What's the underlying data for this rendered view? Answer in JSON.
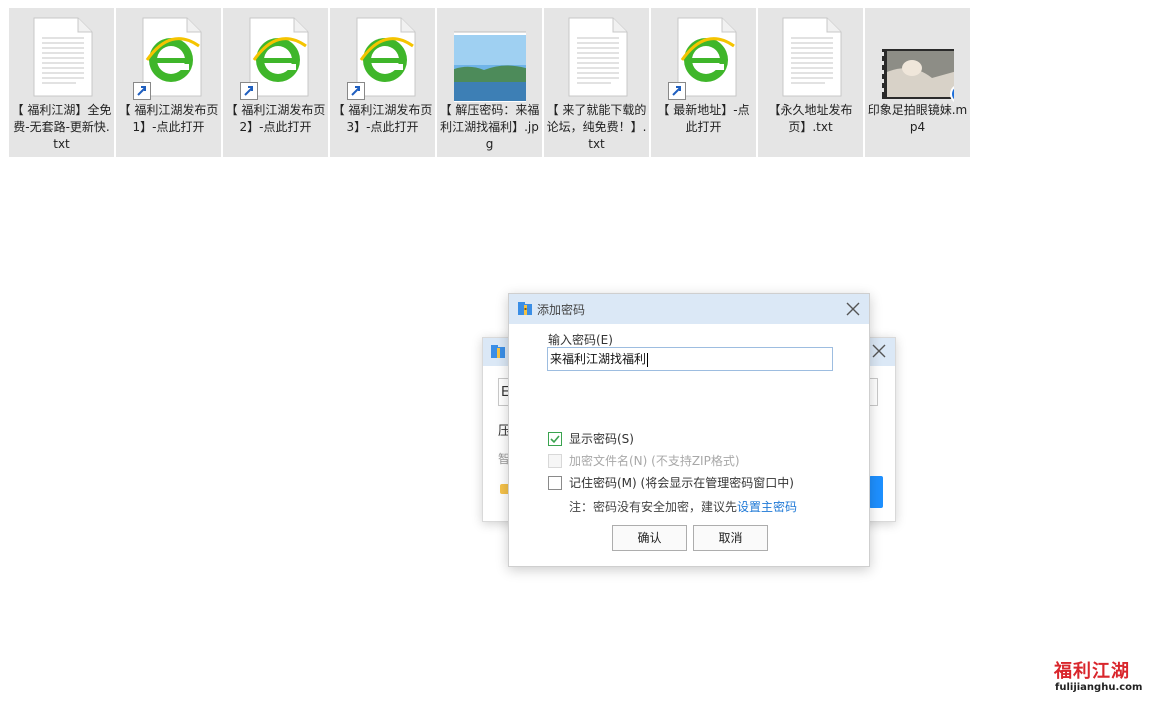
{
  "files": [
    {
      "type": "txt",
      "label": "【 福利江湖】全免费-无套路-更新快.txt"
    },
    {
      "type": "ie-shortcut",
      "label": "【 福利江湖发布页1】-点此打开"
    },
    {
      "type": "ie-shortcut",
      "label": "【 福利江湖发布页2】-点此打开"
    },
    {
      "type": "ie-shortcut",
      "label": "【 福利江湖发布页3】-点此打开"
    },
    {
      "type": "jpg",
      "label": "【 解压密码：来福利江湖找福利】.jpg"
    },
    {
      "type": "txt",
      "label": "【 来了就能下载的论坛，纯免费！】.txt"
    },
    {
      "type": "ie-shortcut",
      "label": "【 最新地址】-点此打开"
    },
    {
      "type": "txt",
      "label": "【永久地址发布页】.txt"
    },
    {
      "type": "mp4",
      "label": "印象足拍眼镜妹.mp4"
    }
  ],
  "background_dialog": {
    "input_text": "E",
    "label1": "压",
    "label2": "智"
  },
  "dialog": {
    "title": "添加密码",
    "password_label": "输入密码(E)",
    "password_value": "来福利江湖找福利",
    "show_password": {
      "label": "显示密码(S)",
      "checked": true
    },
    "encrypt_names": {
      "label": "加密文件名(N) (不支持ZIP格式)",
      "checked": false,
      "disabled": true
    },
    "remember_password": {
      "label": "记住密码(M) (将会显示在管理密码窗口中)",
      "checked": false
    },
    "note_prefix": "注：密码没有安全加密，建议先",
    "note_link": "设置主密码",
    "ok_label": "确认",
    "cancel_label": "取消"
  },
  "watermark": {
    "title": "福利江湖",
    "url": "fulijianghu.com"
  },
  "colors": {
    "titlebar": "#dbe8f6",
    "selection": "#e5e5e5",
    "link": "#1e78d6",
    "checkbox_green": "#3aa34f",
    "watermark_red": "#d9262c"
  }
}
